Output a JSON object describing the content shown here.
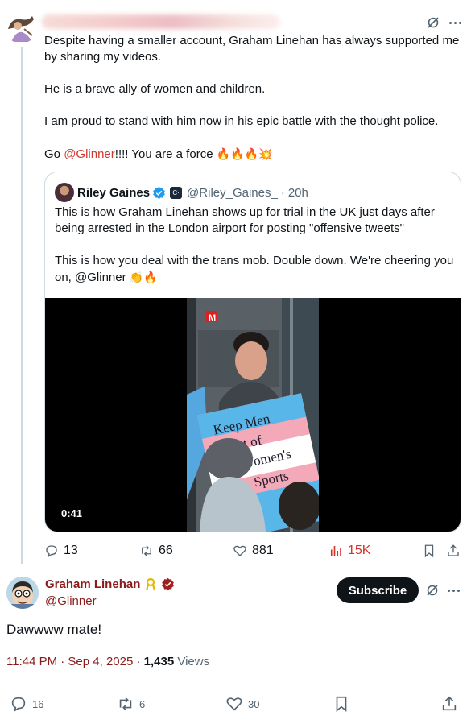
{
  "parent_post": {
    "text": [
      "Despite having a smaller account, Graham Linehan has always supported me by sharing my videos.",
      "He is a brave ally of women and children.",
      "I am proud to stand with him now in his epic battle with the thought police."
    ],
    "go_prefix": "Go ",
    "mention": "@Glinner",
    "go_suffix": "!!!! You are a force ",
    "emojis": "🔥🔥🔥💥",
    "quote": {
      "name": "Riley Gaines",
      "handle": "@Riley_Gaines_",
      "separator": "·",
      "time": "20h",
      "paragraph1": "This is how Graham Linehan shows up for trial in the UK just days after being arrested in the London airport for posting \"offensive tweets\"",
      "paragraph2_prefix": "This is how you deal with the trans mob. Double down. We're cheering you on, ",
      "mention": "@Glinner",
      "emojis": "👏🔥",
      "video": {
        "duration": "0:41",
        "sign_text": [
          "Keep Men",
          "Out of",
          "Women's",
          "Sports"
        ],
        "logo": "M"
      }
    },
    "actions": {
      "replies": "13",
      "reposts": "66",
      "likes": "881",
      "views": "15K"
    }
  },
  "main_post": {
    "name": "Graham Linehan",
    "handle": "@Glinner",
    "subscribe_label": "Subscribe",
    "text": "Dawwww mate!",
    "time": "11:44 PM · Sep 4, 2025 · ",
    "views_count": "1,435",
    "views_label": " Views",
    "actions": {
      "replies": "16",
      "reposts": "6",
      "likes": "30"
    }
  },
  "colors": {
    "link": "#d0362b",
    "main_accent": "#8b1a1a",
    "verified_blue": "#1d9bf0",
    "views_red": "#d0362b"
  }
}
